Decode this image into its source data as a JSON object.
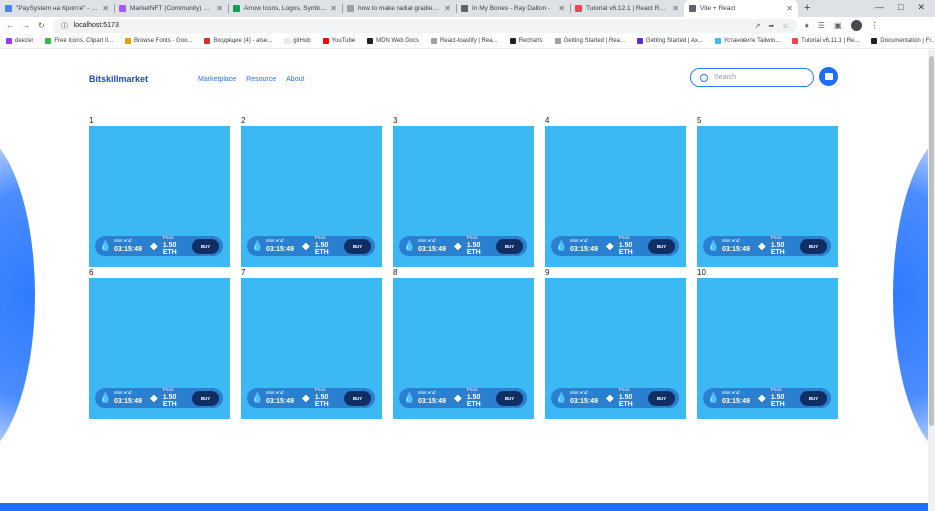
{
  "browser": {
    "tabs": [
      {
        "title": "\"PaySystem на Крипте\" - Goog",
        "color": "#4285f4",
        "active": false
      },
      {
        "title": "MarketNFT (Community) – Figm",
        "color": "#a259ff",
        "active": false
      },
      {
        "title": "Arrow Icons, Logos, Symbols – I",
        "color": "#0f9d58",
        "active": false
      },
      {
        "title": "how to make radial gradient to",
        "color": "#9aa0a6",
        "active": false
      },
      {
        "title": "In My Bones - Ray Dalton -",
        "color": "#5f6368",
        "active": false
      },
      {
        "title": "Tutorial v6.12.1 | React Router",
        "color": "#f44250",
        "active": false
      },
      {
        "title": "Vite + React",
        "color": "#5f6368",
        "active": true
      }
    ],
    "new_tab": "+",
    "url": "localhost:5173",
    "bookmarks": [
      {
        "label": "deezer",
        "color": "#a238ff"
      },
      {
        "label": "Free Icons, Clipart Il...",
        "color": "#2fbf4f"
      },
      {
        "label": "Browse Fonts - Goo...",
        "color": "#f29900"
      },
      {
        "label": "Входящие (4) - alse...",
        "color": "#d93025"
      },
      {
        "label": "gitHub",
        "color": "#e8eaed"
      },
      {
        "label": "YouTube",
        "color": "#ff0000"
      },
      {
        "label": "MDN Web Docs",
        "color": "#202124"
      },
      {
        "label": "React-toastify | Rea...",
        "color": "#9aa0a6"
      },
      {
        "label": "Recharts",
        "color": "#202124"
      },
      {
        "label": "Getting Started | Rea...",
        "color": "#9aa0a6"
      },
      {
        "label": "Getting Started | Ax...",
        "color": "#5a29e4"
      },
      {
        "label": "Установите Tailwin...",
        "color": "#38bdf8"
      },
      {
        "label": "Tutorial v6.11.1 | Re...",
        "color": "#f44250"
      },
      {
        "label": "Documentation | Fr...",
        "color": "#202124"
      }
    ]
  },
  "site": {
    "logo": "Bitskillmarket",
    "nav": [
      "Marketplace",
      "Resource",
      "About"
    ],
    "search_placeholder": "Search",
    "accent": "#1f6fff",
    "card_color": "#3cb9f5",
    "pill_color": "#2a7fd1",
    "button_color": "#0f2f64"
  },
  "cards": [
    {
      "num": "1",
      "mint_label": "Mint end:",
      "mint_time": "03:15:49",
      "price_label": "Price:",
      "price": "1.50 ETH",
      "buy": "BUY"
    },
    {
      "num": "2",
      "mint_label": "Mint end:",
      "mint_time": "03:15:49",
      "price_label": "Price:",
      "price": "1.50 ETH",
      "buy": "BUY"
    },
    {
      "num": "3",
      "mint_label": "Mint end:",
      "mint_time": "03:15:49",
      "price_label": "Price:",
      "price": "1.50 ETH",
      "buy": "BUY"
    },
    {
      "num": "4",
      "mint_label": "Mint end:",
      "mint_time": "03:15:49",
      "price_label": "Price:",
      "price": "1.50 ETH",
      "buy": "BUY"
    },
    {
      "num": "5",
      "mint_label": "Mint end:",
      "mint_time": "03:15:49",
      "price_label": "Price:",
      "price": "1.50 ETH",
      "buy": "BUY"
    },
    {
      "num": "6",
      "mint_label": "Mint end:",
      "mint_time": "03:15:49",
      "price_label": "Price:",
      "price": "1.50 ETH",
      "buy": "BUY"
    },
    {
      "num": "7",
      "mint_label": "Mint end:",
      "mint_time": "03:15:49",
      "price_label": "Price:",
      "price": "1.50 ETH",
      "buy": "BUY"
    },
    {
      "num": "8",
      "mint_label": "Mint end:",
      "mint_time": "03:15:49",
      "price_label": "Price:",
      "price": "1.50 ETH",
      "buy": "BUY"
    },
    {
      "num": "9",
      "mint_label": "Mint end:",
      "mint_time": "03:15:49",
      "price_label": "Price:",
      "price": "1.50 ETH",
      "buy": "BUY"
    },
    {
      "num": "10",
      "mint_label": "Mint end:",
      "mint_time": "03:15:49",
      "price_label": "Price:",
      "price": "1.50 ETH",
      "buy": "BUY"
    }
  ]
}
